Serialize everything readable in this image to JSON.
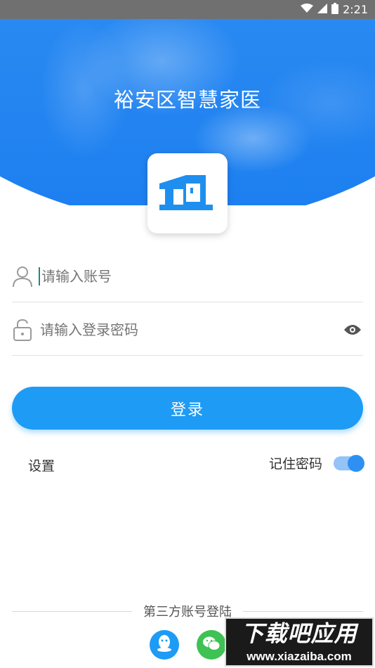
{
  "status_bar": {
    "time": "2:21",
    "icons": [
      "wifi-icon",
      "signal-icon",
      "battery-icon"
    ]
  },
  "header": {
    "title": "裕安区智慧家医"
  },
  "form": {
    "account_placeholder": "请输入账号",
    "password_placeholder": "请输入登录密码"
  },
  "login_button": "登录",
  "settings_label": "设置",
  "remember_password": {
    "label": "记住密码",
    "enabled": true
  },
  "third_party": {
    "label": "第三方账号登陆",
    "providers": [
      "qq-icon",
      "wechat-icon"
    ]
  },
  "watermark": {
    "title": "下载吧应用",
    "url": "www.xiazaiba.com"
  },
  "colors": {
    "primary": "#1e9bf4",
    "header_gradient_top": "#3fa2f5",
    "header_gradient_bottom": "#1c7ff0",
    "wechat_green": "#3ec253"
  }
}
